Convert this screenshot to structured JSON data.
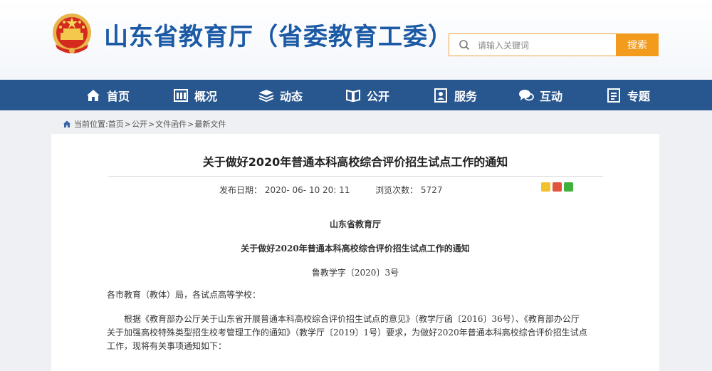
{
  "header": {
    "site_title": "山东省教育厅（省委教育工委）",
    "search_placeholder": "请输入关键词",
    "search_button": "搜索"
  },
  "nav": [
    {
      "label": "首页",
      "icon": "home-icon"
    },
    {
      "label": "概况",
      "icon": "overview-icon"
    },
    {
      "label": "动态",
      "icon": "layers-icon"
    },
    {
      "label": "公开",
      "icon": "book-icon"
    },
    {
      "label": "服务",
      "icon": "service-icon"
    },
    {
      "label": "互动",
      "icon": "chat-icon"
    },
    {
      "label": "专题",
      "icon": "document-icon"
    }
  ],
  "breadcrumb": {
    "prefix": "当前位置:",
    "items": [
      "首页",
      "公开",
      "文件函件",
      "最新文件"
    ]
  },
  "article": {
    "title": "关于做好2020年普通本科高校综合评价招生试点工作的通知",
    "publish_label": "发布日期：",
    "publish_date": "2020- 06- 10 20: 11",
    "views_label": "浏览次数：",
    "views": "5727",
    "issuer": "山东省教育厅",
    "doc_title": "关于做好2020年普通本科高校综合评价招生试点工作的通知",
    "doc_number": "鲁教学字〔2020〕3号",
    "salutation": "各市教育（教体）局，各试点高等学校：",
    "para1_line1": "根据《教育部办公厅关于山东省开展普通本科高校综合评价招生试点的意见》（教学厅函〔2016〕36号）、《教育部办公厅",
    "para1_line2": "关于加强高校特殊类型招生校考管理工作的通知》（教学厅〔2019〕1号）要求，为做好2020年普通本科高校综合评价招生试点",
    "para1_line3": "工作，现将有关事项通知如下："
  },
  "colors": {
    "brand_blue": "#1c5aa6",
    "nav_bg": "#28578f",
    "search_orange": "#f29b1c"
  }
}
